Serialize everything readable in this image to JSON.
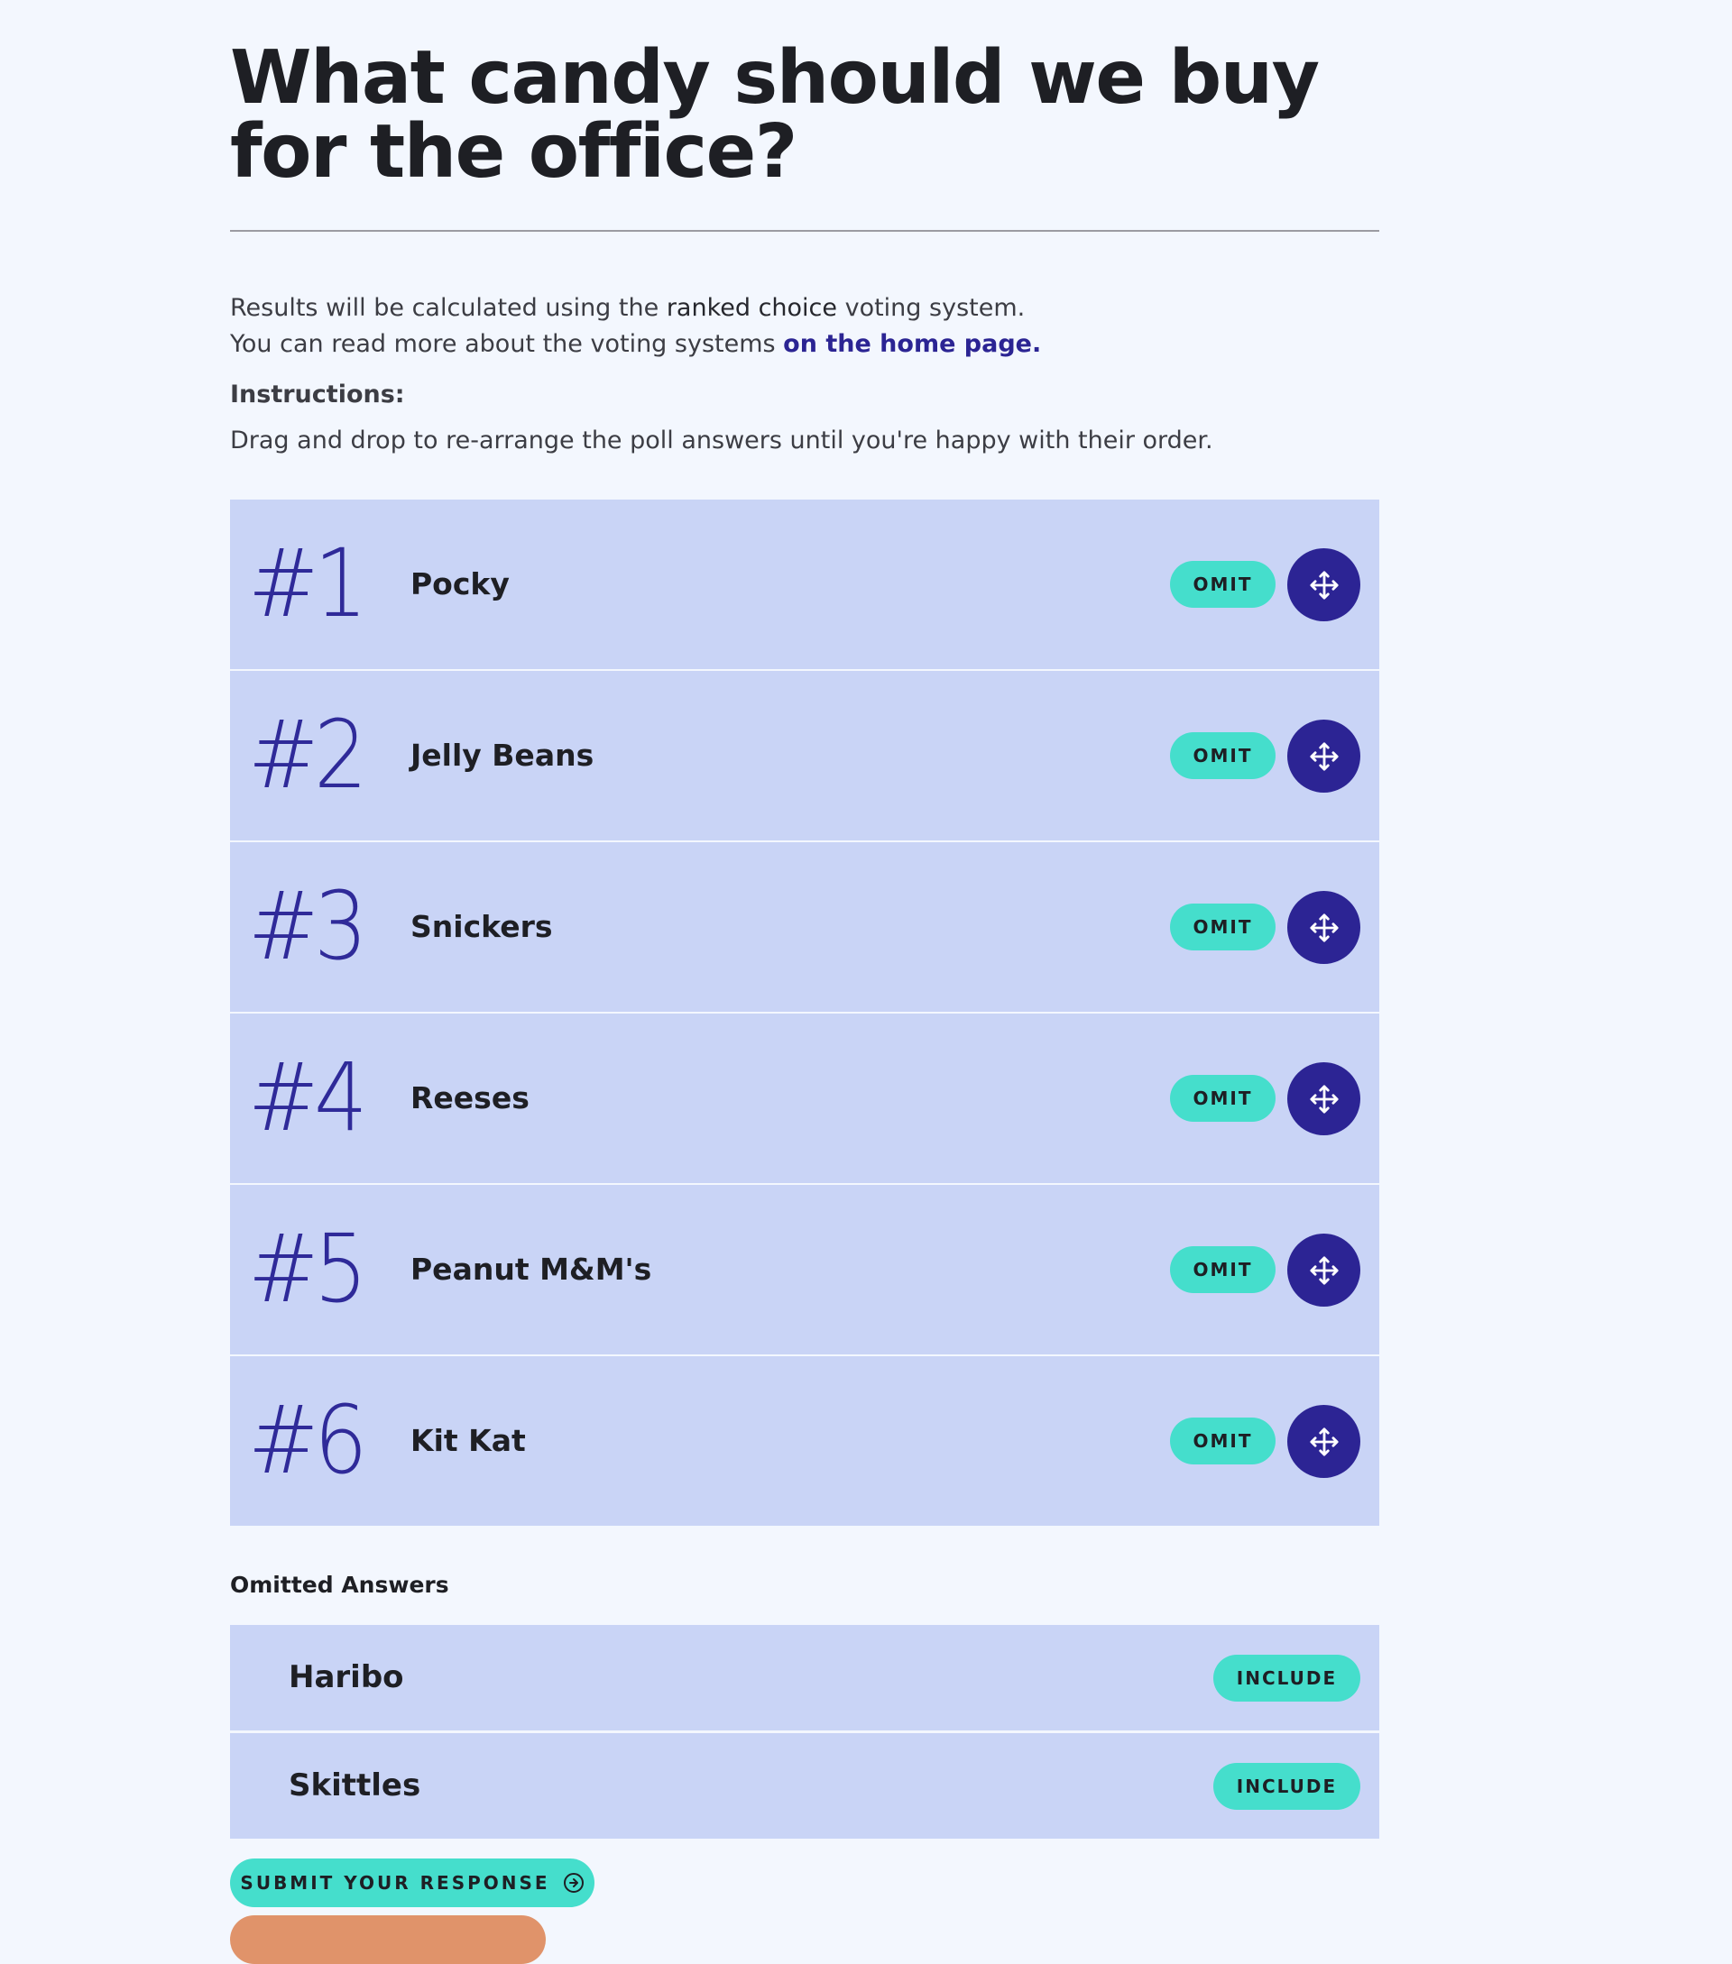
{
  "poll": {
    "title": "What candy should we buy for the office?"
  },
  "intro": {
    "line1_before": "Results will be calculated using the ",
    "line1_strong": "ranked choice",
    "line1_after": " voting system.",
    "line2_before": "You can read more about the voting systems ",
    "line2_link": "on the home page."
  },
  "instructions": {
    "label": "Instructions:",
    "text": "Drag and drop to re-arrange the poll answers until you're happy with their order."
  },
  "ranked": {
    "omit_label": "OMIT",
    "items": [
      {
        "rank": "#1",
        "label": "Pocky"
      },
      {
        "rank": "#2",
        "label": "Jelly Beans"
      },
      {
        "rank": "#3",
        "label": "Snickers"
      },
      {
        "rank": "#4",
        "label": "Reeses"
      },
      {
        "rank": "#5",
        "label": "Peanut M&M's"
      },
      {
        "rank": "#6",
        "label": "Kit Kat"
      }
    ]
  },
  "omitted": {
    "heading": "Omitted Answers",
    "include_label": "INCLUDE",
    "items": [
      {
        "label": "Haribo"
      },
      {
        "label": "Skittles"
      }
    ]
  },
  "submit": {
    "label": "SUBMIT YOUR RESPONSE"
  },
  "icons": {
    "drag": "move-arrows-icon",
    "submit": "arrow-circle-right-icon"
  },
  "colors": {
    "background": "#f3f7fe",
    "row": "#c9d4f6",
    "accent_teal": "#45decc",
    "accent_indigo": "#2c2494",
    "link": "#2b2493",
    "peek_orange": "#e0936a"
  }
}
